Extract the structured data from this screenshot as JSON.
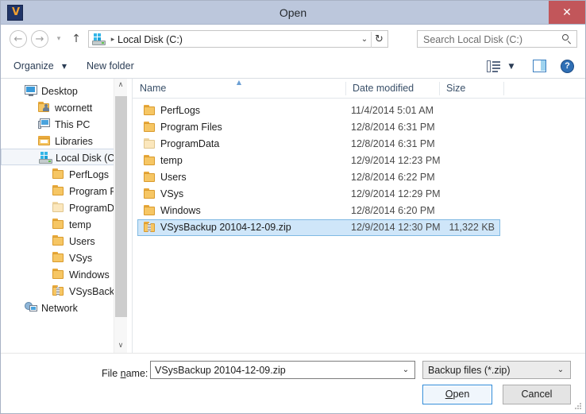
{
  "window": {
    "title": "Open",
    "app_icon": "vsys-app-icon",
    "close_label": "✕"
  },
  "nav": {
    "back_icon": "←",
    "forward_icon": "→",
    "recent_icon": "▾",
    "up_icon": "↑",
    "address": {
      "drive_icon": "local-disk-icon",
      "separator": "▸",
      "path": "Local Disk (C:)",
      "chevron": "⌄",
      "refresh_icon": "↻"
    },
    "search": {
      "placeholder": "Search Local Disk (C:)",
      "icon": "search-icon"
    }
  },
  "toolbar": {
    "organize_label": "Organize",
    "organize_arrow": "▼",
    "new_folder_label": "New folder",
    "view_icon": "view-options-icon",
    "view_arrow": "▼",
    "preview_pane_icon": "preview-pane-icon",
    "help_icon": "?"
  },
  "sidebar": {
    "items": [
      {
        "label": "Desktop",
        "icon": "monitor-icon",
        "indent": 0,
        "selected": false
      },
      {
        "label": "wcornett",
        "icon": "user-folder-icon",
        "indent": 1,
        "selected": false
      },
      {
        "label": "This PC",
        "icon": "computer-icon",
        "indent": 1,
        "selected": false
      },
      {
        "label": "Libraries",
        "icon": "libraries-icon",
        "indent": 1,
        "selected": false
      },
      {
        "label": "Local Disk (C:)",
        "icon": "local-disk-icon",
        "indent": 1,
        "selected": true
      },
      {
        "label": "PerfLogs",
        "icon": "folder-icon",
        "indent": 2,
        "selected": false
      },
      {
        "label": "Program Fi",
        "icon": "folder-icon",
        "indent": 2,
        "selected": false
      },
      {
        "label": "ProgramDa",
        "icon": "folder-faded-icon",
        "indent": 2,
        "selected": false
      },
      {
        "label": "temp",
        "icon": "folder-icon",
        "indent": 2,
        "selected": false
      },
      {
        "label": "Users",
        "icon": "folder-icon",
        "indent": 2,
        "selected": false
      },
      {
        "label": "VSys",
        "icon": "folder-icon",
        "indent": 2,
        "selected": false
      },
      {
        "label": "Windows",
        "icon": "folder-icon",
        "indent": 2,
        "selected": false
      },
      {
        "label": "VSysBackup",
        "icon": "zip-icon",
        "indent": 2,
        "selected": false
      },
      {
        "label": "Network",
        "icon": "network-icon",
        "indent": 0,
        "selected": false
      }
    ],
    "scroll_up": "∧",
    "scroll_down": "∨"
  },
  "filelist": {
    "columns": [
      {
        "label": "Name",
        "sorted": "asc"
      },
      {
        "label": "Date modified",
        "sorted": ""
      },
      {
        "label": "Size",
        "sorted": ""
      }
    ],
    "sort_arrow": "▲",
    "rows": [
      {
        "name": "PerfLogs",
        "date": "11/4/2014 5:01 AM",
        "size": "",
        "icon": "folder-icon",
        "selected": false
      },
      {
        "name": "Program Files",
        "date": "12/8/2014 6:31 PM",
        "size": "",
        "icon": "folder-icon",
        "selected": false
      },
      {
        "name": "ProgramData",
        "date": "12/8/2014 6:31 PM",
        "size": "",
        "icon": "folder-faded-icon",
        "selected": false
      },
      {
        "name": "temp",
        "date": "12/9/2014 12:23 PM",
        "size": "",
        "icon": "folder-icon",
        "selected": false
      },
      {
        "name": "Users",
        "date": "12/8/2014 6:22 PM",
        "size": "",
        "icon": "folder-icon",
        "selected": false
      },
      {
        "name": "VSys",
        "date": "12/9/2014 12:29 PM",
        "size": "",
        "icon": "folder-icon",
        "selected": false
      },
      {
        "name": "Windows",
        "date": "12/8/2014 6:20 PM",
        "size": "",
        "icon": "folder-icon",
        "selected": false
      },
      {
        "name": "VSysBackup 20104-12-09.zip",
        "date": "12/9/2014 12:30 PM",
        "size": "11,322 KB",
        "icon": "zip-icon",
        "selected": true
      }
    ]
  },
  "footer": {
    "filename_label_pre": "File ",
    "filename_label_key": "n",
    "filename_label_post": "ame:",
    "filename_value": "VSysBackup 20104-12-09.zip",
    "filename_chevron": "⌄",
    "filetype_value": "Backup files (*.zip)",
    "filetype_chevron": "⌄",
    "open_label_key": "O",
    "open_label_post": "pen",
    "cancel_label": "Cancel",
    "resize_grip": "resize-grip"
  },
  "colors": {
    "titlebar": "#bcc7dc",
    "close": "#c2565a",
    "selection": "#cfe6f9",
    "selection_border": "#7fb9e3",
    "accent": "#2f8ad8",
    "header_text": "#3a5069"
  }
}
